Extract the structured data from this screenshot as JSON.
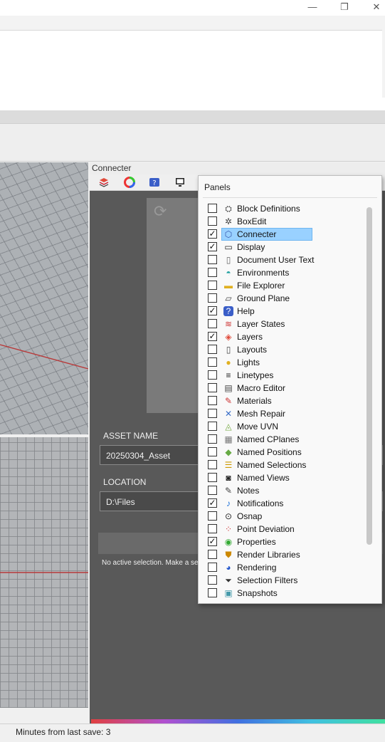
{
  "window": {
    "minimize": "—",
    "restore": "❐",
    "close": "✕"
  },
  "panel": {
    "title": "Connecter",
    "tabs": [
      "layers-icon",
      "color-wheel-icon",
      "help-icon",
      "display-icon"
    ],
    "asset_name_label": "ASSET NAME",
    "asset_name_value": "20250304_Asset",
    "location_label": "LOCATION",
    "location_value": "D:\\Files",
    "status_message": "No active selection. Make a sel"
  },
  "panels_menu": {
    "title": "Panels",
    "items": [
      {
        "label": "Block Definitions",
        "checked": false,
        "icon": "block-icon"
      },
      {
        "label": "BoxEdit",
        "checked": false,
        "icon": "boxedit-icon"
      },
      {
        "label": "Connecter",
        "checked": true,
        "icon": "connecter-icon",
        "highlighted": true
      },
      {
        "label": "Display",
        "checked": true,
        "icon": "display-icon"
      },
      {
        "label": "Document User Text",
        "checked": false,
        "icon": "document-icon"
      },
      {
        "label": "Environments",
        "checked": false,
        "icon": "environment-icon"
      },
      {
        "label": "File Explorer",
        "checked": false,
        "icon": "folder-icon"
      },
      {
        "label": "Ground Plane",
        "checked": false,
        "icon": "ground-plane-icon"
      },
      {
        "label": "Help",
        "checked": true,
        "icon": "help-icon"
      },
      {
        "label": "Layer States",
        "checked": false,
        "icon": "layer-states-icon"
      },
      {
        "label": "Layers",
        "checked": true,
        "icon": "layers-icon"
      },
      {
        "label": "Layouts",
        "checked": false,
        "icon": "layouts-icon"
      },
      {
        "label": "Lights",
        "checked": false,
        "icon": "light-icon"
      },
      {
        "label": "Linetypes",
        "checked": false,
        "icon": "linetypes-icon"
      },
      {
        "label": "Macro Editor",
        "checked": false,
        "icon": "macro-icon"
      },
      {
        "label": "Materials",
        "checked": false,
        "icon": "materials-icon"
      },
      {
        "label": "Mesh Repair",
        "checked": false,
        "icon": "mesh-repair-icon"
      },
      {
        "label": "Move UVN",
        "checked": false,
        "icon": "move-uvn-icon"
      },
      {
        "label": "Named CPlanes",
        "checked": false,
        "icon": "cplane-icon"
      },
      {
        "label": "Named Positions",
        "checked": false,
        "icon": "named-positions-icon"
      },
      {
        "label": "Named Selections",
        "checked": false,
        "icon": "named-selections-icon"
      },
      {
        "label": "Named Views",
        "checked": false,
        "icon": "camera-icon"
      },
      {
        "label": "Notes",
        "checked": false,
        "icon": "notes-icon"
      },
      {
        "label": "Notifications",
        "checked": true,
        "icon": "bell-icon"
      },
      {
        "label": "Osnap",
        "checked": false,
        "icon": "osnap-icon"
      },
      {
        "label": "Point Deviation",
        "checked": false,
        "icon": "point-deviation-icon"
      },
      {
        "label": "Properties",
        "checked": true,
        "icon": "color-wheel-icon"
      },
      {
        "label": "Render Libraries",
        "checked": false,
        "icon": "render-libraries-icon"
      },
      {
        "label": "Rendering",
        "checked": false,
        "icon": "rendering-icon"
      },
      {
        "label": "Selection Filters",
        "checked": false,
        "icon": "filter-icon"
      },
      {
        "label": "Snapshots",
        "checked": false,
        "icon": "snapshot-icon"
      }
    ]
  },
  "statusbar": {
    "text": "Minutes from last save: 3"
  }
}
